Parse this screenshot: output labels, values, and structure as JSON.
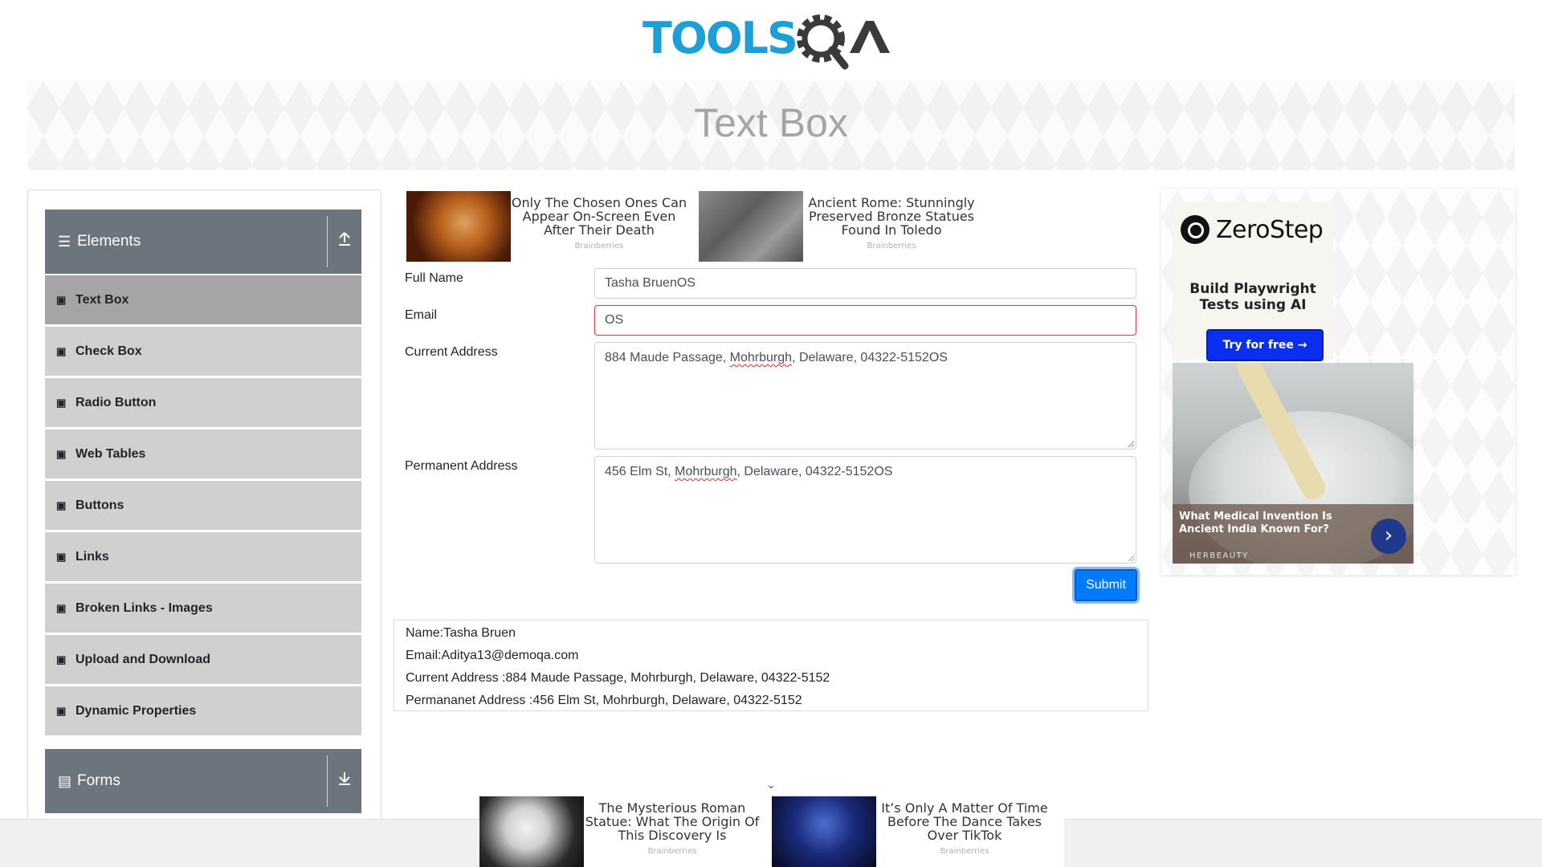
{
  "logo": {
    "text_primary": "TOOLS",
    "text_secondary": "QA",
    "primary_color": "#1c9ed9",
    "secondary_color": "#3a3a3a"
  },
  "banner": {
    "title": "Text Box"
  },
  "sidebar": {
    "groups": [
      {
        "label": "Elements",
        "icon": "hamburger-icon",
        "arrow_icon": "upload-arrow-icon",
        "expanded": true
      },
      {
        "label": "Forms",
        "icon": "document-icon",
        "arrow_icon": "download-arrow-icon",
        "expanded": false
      }
    ],
    "items": [
      {
        "label": "Text Box",
        "active": true
      },
      {
        "label": "Check Box"
      },
      {
        "label": "Radio Button"
      },
      {
        "label": "Web Tables"
      },
      {
        "label": "Buttons"
      },
      {
        "label": "Links"
      },
      {
        "label": "Broken Links - Images"
      },
      {
        "label": "Upload and Download"
      },
      {
        "label": "Dynamic Properties"
      }
    ]
  },
  "top_ads": [
    {
      "title": "Only The Chosen Ones Can Appear On-Screen Even After Their Death",
      "source": "Brainberries"
    },
    {
      "title": "Ancient Rome: Stunningly Preserved Bronze Statues Found In Toledo",
      "source": "Brainberries"
    }
  ],
  "form": {
    "full_name": {
      "label": "Full Name",
      "value": "Tasha BruenOS"
    },
    "email": {
      "label": "Email",
      "value": "OS",
      "invalid": true
    },
    "current_address": {
      "label": "Current Address",
      "value_pre": "884 Maude Passage, ",
      "value_spell": "Mohrburgh",
      "value_post": ", Delaware, 04322-5152OS"
    },
    "permanent_address": {
      "label": "Permanent Address",
      "value_pre": "456 Elm St, ",
      "value_spell": "Mohrburgh",
      "value_post": ", Delaware, 04322-5152OS"
    },
    "submit_label": "Submit"
  },
  "output": {
    "name": "Name:Tasha Bruen",
    "email": "Email:Aditya13@demoqa.com",
    "current_address": "Current Address :884 Maude Passage, Mohrburgh, Delaware, 04322-5152",
    "permanent_address": "Permananet Address :456 Elm St, Mohrburgh, Delaware, 04322-5152"
  },
  "right_ad": {
    "brand": "ZeroStep",
    "tagline": "Build Playwright Tests using AI",
    "cta": "Try for free →",
    "story_title": "What Medical Invention Is Ancient India Known For?",
    "story_source": "HERBEAUTY"
  },
  "bottom_ads": [
    {
      "title": "The Mysterious Roman Statue: What The Origin Of This Discovery Is",
      "source": "Brainberries"
    },
    {
      "title": "It’s Only A Matter Of Time Before The Dance Takes Over TikTok",
      "source": "Brainberries"
    }
  ],
  "colors": {
    "sidebar_header": "#6c757d",
    "menu_item": "#d0d0d0",
    "menu_item_active": "#a5a5a5",
    "submit": "#007bff",
    "error": "#dc3545"
  }
}
